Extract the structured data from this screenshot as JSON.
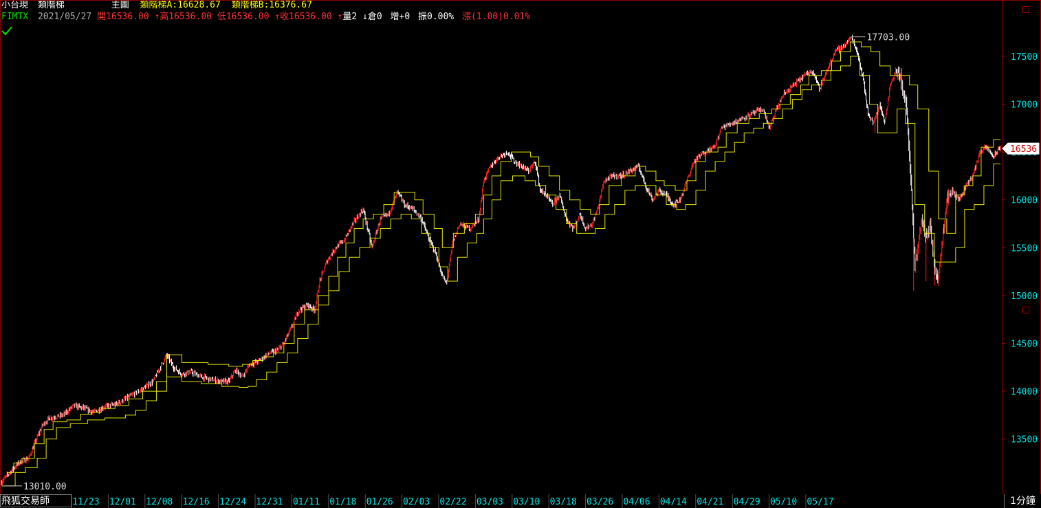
{
  "header": {
    "row1": {
      "instrument": "小台現",
      "indicator_name": "類階梯",
      "panel_label": "主圖",
      "ladder_a": "類階梯A:16628.67",
      "ladder_b": "類階梯B:16376.67"
    },
    "row2": {
      "symbol": "FIMTX",
      "date": "2021/05/27",
      "open": "開16536.00",
      "high": "高16536.00",
      "low": "低16536.00",
      "close": "收16536.00",
      "volume": "量2",
      "open_interest": "倉0",
      "oi_change": "增+0",
      "amplitude": "振0.00%",
      "change": "漲(1.00)0.01%"
    }
  },
  "colors": {
    "up": "#ff2020",
    "down": "#ffffff",
    "ladder": "#e6e600",
    "axis_text": "#00e5e5",
    "frame": "#8b0000",
    "header_label": "#ffff00"
  },
  "annotations": {
    "high_label": "17703.00",
    "low_label": "13010.00",
    "last_price": "16536"
  },
  "footer": {
    "tab_label": "飛狐交易師",
    "timeframe": "1分鐘"
  },
  "chart_data": {
    "type": "candlestick",
    "title": "",
    "y_ticks": [
      13500,
      14000,
      14500,
      15000,
      15500,
      16000,
      16500,
      17000,
      17500
    ],
    "ylim": [
      12930,
      17830
    ],
    "x_tick_labels": [
      "11/23",
      "12/01",
      "12/08",
      "12/16",
      "12/24",
      "12/31",
      "01/11",
      "01/18",
      "01/26",
      "02/03",
      "02/22",
      "03/03",
      "03/10",
      "03/18",
      "03/26",
      "04/06",
      "04/14",
      "04/21",
      "04/29",
      "05/10",
      "05/17"
    ],
    "price_path": [
      [
        0,
        13050
      ],
      [
        12,
        13150
      ],
      [
        25,
        13250
      ],
      [
        40,
        13300
      ],
      [
        48,
        13450
      ],
      [
        60,
        13650
      ],
      [
        70,
        13720
      ],
      [
        90,
        13750
      ],
      [
        105,
        13850
      ],
      [
        120,
        13820
      ],
      [
        135,
        13780
      ],
      [
        150,
        13840
      ],
      [
        165,
        13860
      ],
      [
        180,
        13920
      ],
      [
        200,
        14000
      ],
      [
        220,
        14100
      ],
      [
        240,
        14380
      ],
      [
        250,
        14250
      ],
      [
        262,
        14180
      ],
      [
        275,
        14200
      ],
      [
        290,
        14150
      ],
      [
        305,
        14120
      ],
      [
        320,
        14100
      ],
      [
        330,
        14100
      ],
      [
        340,
        14220
      ],
      [
        350,
        14150
      ],
      [
        360,
        14280
      ],
      [
        370,
        14300
      ],
      [
        380,
        14350
      ],
      [
        390,
        14400
      ],
      [
        400,
        14420
      ],
      [
        410,
        14500
      ],
      [
        420,
        14650
      ],
      [
        432,
        14850
      ],
      [
        445,
        14900
      ],
      [
        455,
        14850
      ],
      [
        462,
        15150
      ],
      [
        472,
        15350
      ],
      [
        485,
        15500
      ],
      [
        498,
        15580
      ],
      [
        510,
        15750
      ],
      [
        525,
        15900
      ],
      [
        538,
        15500
      ],
      [
        550,
        15800
      ],
      [
        562,
        15850
      ],
      [
        575,
        16080
      ],
      [
        585,
        15950
      ],
      [
        598,
        15900
      ],
      [
        610,
        15800
      ],
      [
        620,
        15600
      ],
      [
        630,
        15450
      ],
      [
        640,
        15200
      ],
      [
        646,
        15120
      ],
      [
        655,
        15550
      ],
      [
        665,
        15750
      ],
      [
        680,
        15700
      ],
      [
        693,
        15800
      ],
      [
        700,
        16200
      ],
      [
        710,
        16350
      ],
      [
        722,
        16450
      ],
      [
        735,
        16500
      ],
      [
        745,
        16400
      ],
      [
        755,
        16350
      ],
      [
        765,
        16300
      ],
      [
        775,
        16400
      ],
      [
        782,
        16100
      ],
      [
        790,
        16050
      ],
      [
        800,
        15950
      ],
      [
        810,
        16050
      ],
      [
        820,
        15800
      ],
      [
        830,
        15700
      ],
      [
        840,
        15850
      ],
      [
        848,
        15700
      ],
      [
        858,
        15750
      ],
      [
        865,
        15900
      ],
      [
        875,
        16200
      ],
      [
        888,
        16250
      ],
      [
        900,
        16250
      ],
      [
        912,
        16300
      ],
      [
        925,
        16350
      ],
      [
        935,
        16150
      ],
      [
        945,
        16000
      ],
      [
        955,
        16100
      ],
      [
        965,
        16050
      ],
      [
        975,
        15950
      ],
      [
        985,
        16000
      ],
      [
        995,
        16200
      ],
      [
        1005,
        16400
      ],
      [
        1020,
        16500
      ],
      [
        1035,
        16550
      ],
      [
        1045,
        16750
      ],
      [
        1060,
        16800
      ],
      [
        1075,
        16850
      ],
      [
        1090,
        16900
      ],
      [
        1105,
        16950
      ],
      [
        1115,
        16750
      ],
      [
        1125,
        16950
      ],
      [
        1135,
        17100
      ],
      [
        1150,
        17200
      ],
      [
        1165,
        17300
      ],
      [
        1178,
        17350
      ],
      [
        1188,
        17150
      ],
      [
        1198,
        17350
      ],
      [
        1210,
        17550
      ],
      [
        1222,
        17600
      ],
      [
        1234,
        17703
      ],
      [
        1242,
        17550
      ],
      [
        1250,
        17300
      ],
      [
        1258,
        16900
      ],
      [
        1266,
        16800
      ],
      [
        1275,
        17000
      ],
      [
        1282,
        16800
      ],
      [
        1290,
        17200
      ],
      [
        1298,
        17350
      ],
      [
        1306,
        17250
      ],
      [
        1314,
        16950
      ],
      [
        1320,
        16200
      ],
      [
        1326,
        15300
      ],
      [
        1330,
        15500
      ],
      [
        1336,
        15800
      ],
      [
        1342,
        15600
      ],
      [
        1348,
        15750
      ],
      [
        1354,
        15300
      ],
      [
        1360,
        15200
      ],
      [
        1366,
        15600
      ],
      [
        1372,
        16000
      ],
      [
        1380,
        16100
      ],
      [
        1390,
        16000
      ],
      [
        1400,
        16150
      ],
      [
        1410,
        16250
      ],
      [
        1420,
        16500
      ],
      [
        1430,
        16550
      ],
      [
        1440,
        16450
      ],
      [
        1450,
        16550
      ]
    ],
    "ladder_a": [
      [
        8,
        13150
      ],
      [
        18,
        13250
      ],
      [
        30,
        13300
      ],
      [
        48,
        13450
      ],
      [
        62,
        13600
      ],
      [
        75,
        13680
      ],
      [
        95,
        13700
      ],
      [
        115,
        13760
      ],
      [
        130,
        13780
      ],
      [
        145,
        13820
      ],
      [
        165,
        13850
      ],
      [
        185,
        13920
      ],
      [
        205,
        14000
      ],
      [
        225,
        14100
      ],
      [
        240,
        14380
      ],
      [
        262,
        14300
      ],
      [
        300,
        14280
      ],
      [
        330,
        14260
      ],
      [
        350,
        14280
      ],
      [
        365,
        14320
      ],
      [
        380,
        14360
      ],
      [
        395,
        14400
      ],
      [
        410,
        14500
      ],
      [
        425,
        14700
      ],
      [
        440,
        14850
      ],
      [
        460,
        15000
      ],
      [
        475,
        15200
      ],
      [
        488,
        15400
      ],
      [
        500,
        15550
      ],
      [
        512,
        15700
      ],
      [
        525,
        15800
      ],
      [
        540,
        15850
      ],
      [
        555,
        15950
      ],
      [
        570,
        16080
      ],
      [
        600,
        16000
      ],
      [
        612,
        15850
      ],
      [
        628,
        15700
      ],
      [
        640,
        15500
      ],
      [
        656,
        15650
      ],
      [
        672,
        15750
      ],
      [
        688,
        15850
      ],
      [
        700,
        16050
      ],
      [
        712,
        16250
      ],
      [
        725,
        16400
      ],
      [
        740,
        16500
      ],
      [
        768,
        16450
      ],
      [
        780,
        16350
      ],
      [
        795,
        16250
      ],
      [
        810,
        16100
      ],
      [
        825,
        16000
      ],
      [
        840,
        15900
      ],
      [
        855,
        15850
      ],
      [
        868,
        15950
      ],
      [
        882,
        16150
      ],
      [
        900,
        16250
      ],
      [
        920,
        16350
      ],
      [
        935,
        16300
      ],
      [
        950,
        16200
      ],
      [
        962,
        16150
      ],
      [
        978,
        16100
      ],
      [
        995,
        16200
      ],
      [
        1008,
        16400
      ],
      [
        1022,
        16500
      ],
      [
        1040,
        16550
      ],
      [
        1052,
        16700
      ],
      [
        1068,
        16800
      ],
      [
        1085,
        16850
      ],
      [
        1100,
        16900
      ],
      [
        1118,
        16950
      ],
      [
        1130,
        17000
      ],
      [
        1145,
        17100
      ],
      [
        1160,
        17200
      ],
      [
        1172,
        17300
      ],
      [
        1190,
        17350
      ],
      [
        1205,
        17450
      ],
      [
        1218,
        17550
      ],
      [
        1232,
        17650
      ],
      [
        1248,
        17600
      ],
      [
        1262,
        17550
      ],
      [
        1275,
        17400
      ],
      [
        1290,
        17300
      ],
      [
        1305,
        17300
      ],
      [
        1318,
        17200
      ],
      [
        1330,
        16950
      ],
      [
        1346,
        16300
      ],
      [
        1360,
        15800
      ],
      [
        1372,
        15650
      ],
      [
        1385,
        16050
      ],
      [
        1398,
        16150
      ],
      [
        1410,
        16250
      ],
      [
        1422,
        16550
      ],
      [
        1440,
        16629
      ],
      [
        1450,
        16629
      ]
    ],
    "ladder_b": [
      [
        0,
        13010
      ],
      [
        20,
        13150
      ],
      [
        35,
        13200
      ],
      [
        52,
        13300
      ],
      [
        65,
        13500
      ],
      [
        80,
        13620
      ],
      [
        100,
        13660
      ],
      [
        125,
        13700
      ],
      [
        150,
        13720
      ],
      [
        180,
        13750
      ],
      [
        195,
        13800
      ],
      [
        210,
        13900
      ],
      [
        225,
        14000
      ],
      [
        240,
        14150
      ],
      [
        262,
        14100
      ],
      [
        290,
        14080
      ],
      [
        320,
        14050
      ],
      [
        345,
        14040
      ],
      [
        358,
        14050
      ],
      [
        370,
        14120
      ],
      [
        385,
        14200
      ],
      [
        400,
        14300
      ],
      [
        415,
        14400
      ],
      [
        430,
        14550
      ],
      [
        445,
        14700
      ],
      [
        460,
        14900
      ],
      [
        475,
        15050
      ],
      [
        490,
        15250
      ],
      [
        505,
        15400
      ],
      [
        520,
        15500
      ],
      [
        535,
        15600
      ],
      [
        550,
        15700
      ],
      [
        565,
        15800
      ],
      [
        580,
        15850
      ],
      [
        595,
        15800
      ],
      [
        610,
        15650
      ],
      [
        622,
        15500
      ],
      [
        635,
        15300
      ],
      [
        648,
        15150
      ],
      [
        662,
        15400
      ],
      [
        676,
        15550
      ],
      [
        690,
        15650
      ],
      [
        700,
        15800
      ],
      [
        712,
        16000
      ],
      [
        725,
        16200
      ],
      [
        742,
        16250
      ],
      [
        760,
        16200
      ],
      [
        775,
        16150
      ],
      [
        790,
        16050
      ],
      [
        805,
        15900
      ],
      [
        820,
        15750
      ],
      [
        835,
        15650
      ],
      [
        850,
        15650
      ],
      [
        862,
        15700
      ],
      [
        876,
        15850
      ],
      [
        890,
        15950
      ],
      [
        905,
        16100
      ],
      [
        920,
        16150
      ],
      [
        935,
        16150
      ],
      [
        950,
        16050
      ],
      [
        965,
        15950
      ],
      [
        980,
        15900
      ],
      [
        993,
        15950
      ],
      [
        1008,
        16100
      ],
      [
        1022,
        16300
      ],
      [
        1036,
        16400
      ],
      [
        1050,
        16500
      ],
      [
        1064,
        16600
      ],
      [
        1078,
        16700
      ],
      [
        1092,
        16750
      ],
      [
        1106,
        16800
      ],
      [
        1120,
        16850
      ],
      [
        1134,
        16950
      ],
      [
        1148,
        17050
      ],
      [
        1162,
        17150
      ],
      [
        1176,
        17200
      ],
      [
        1190,
        17250
      ],
      [
        1204,
        17350
      ],
      [
        1218,
        17400
      ],
      [
        1232,
        17500
      ],
      [
        1246,
        17300
      ],
      [
        1260,
        17000
      ],
      [
        1272,
        16700
      ],
      [
        1288,
        16700
      ],
      [
        1300,
        16950
      ],
      [
        1312,
        16800
      ],
      [
        1326,
        15950
      ],
      [
        1340,
        15650
      ],
      [
        1354,
        15350
      ],
      [
        1370,
        15350
      ],
      [
        1385,
        15500
      ],
      [
        1398,
        15900
      ],
      [
        1412,
        15950
      ],
      [
        1426,
        16150
      ],
      [
        1440,
        16376
      ],
      [
        1450,
        16376
      ]
    ]
  }
}
